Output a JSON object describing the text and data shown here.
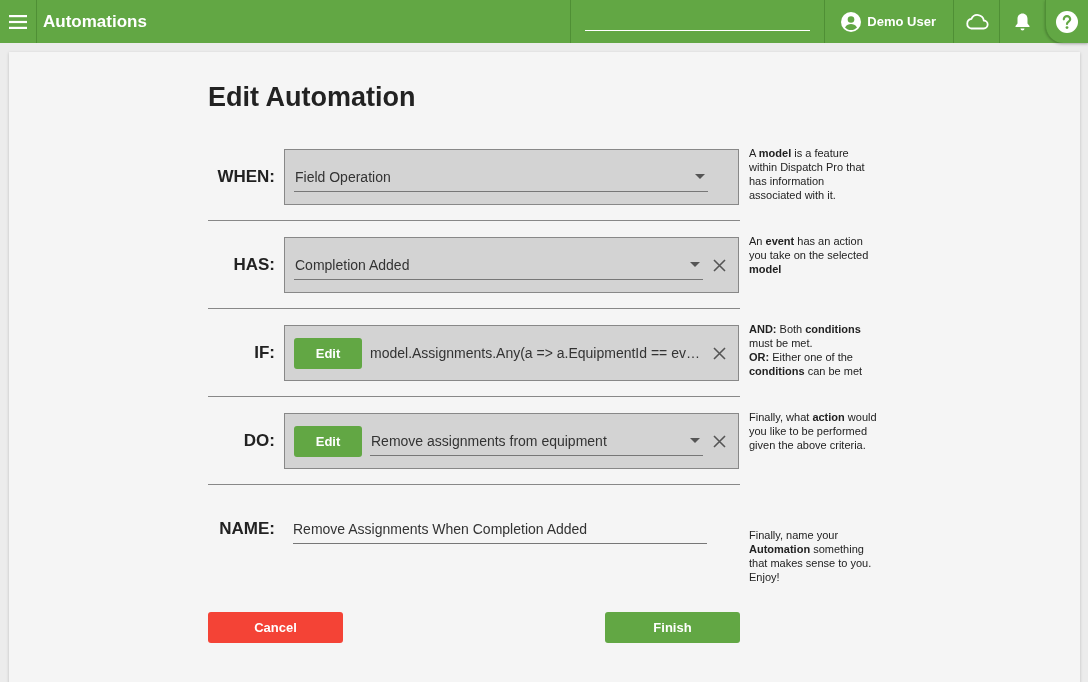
{
  "app_bar": {
    "title": "Automations",
    "user": "Demo User"
  },
  "page": {
    "title": "Edit Automation",
    "rows": [
      {
        "kind": "select",
        "label": "WHEN:",
        "value": "Field Operation",
        "clearable": false,
        "help": "A **model** is a feature within Dispatch Pro that has information associated with it."
      },
      {
        "kind": "select",
        "label": "HAS:",
        "value": "Completion Added",
        "clearable": true,
        "help": "An **event** has an action you take on the selected **model**"
      },
      {
        "kind": "condition",
        "label": "IF:",
        "edit_button": "Edit",
        "value": "model.Assignments.Any(a => a.EquipmentId == ev…",
        "clearable": true,
        "help": "**AND:** Both **conditions** must be met.\n**OR:** Either one of the **conditions** can be met"
      },
      {
        "kind": "action",
        "label": "DO:",
        "edit_button": "Edit",
        "value": "Remove assignments from equipment",
        "clearable": true,
        "help": "Finally, what **action** would you like to be performed given the above criteria."
      },
      {
        "kind": "text",
        "label": "NAME:",
        "value": "Remove Assignments When Completion Added",
        "help": "Finally, name your **Automation** something that makes sense to you. Enjoy!"
      }
    ],
    "buttons": {
      "cancel": "Cancel",
      "finish": "Finish"
    }
  }
}
